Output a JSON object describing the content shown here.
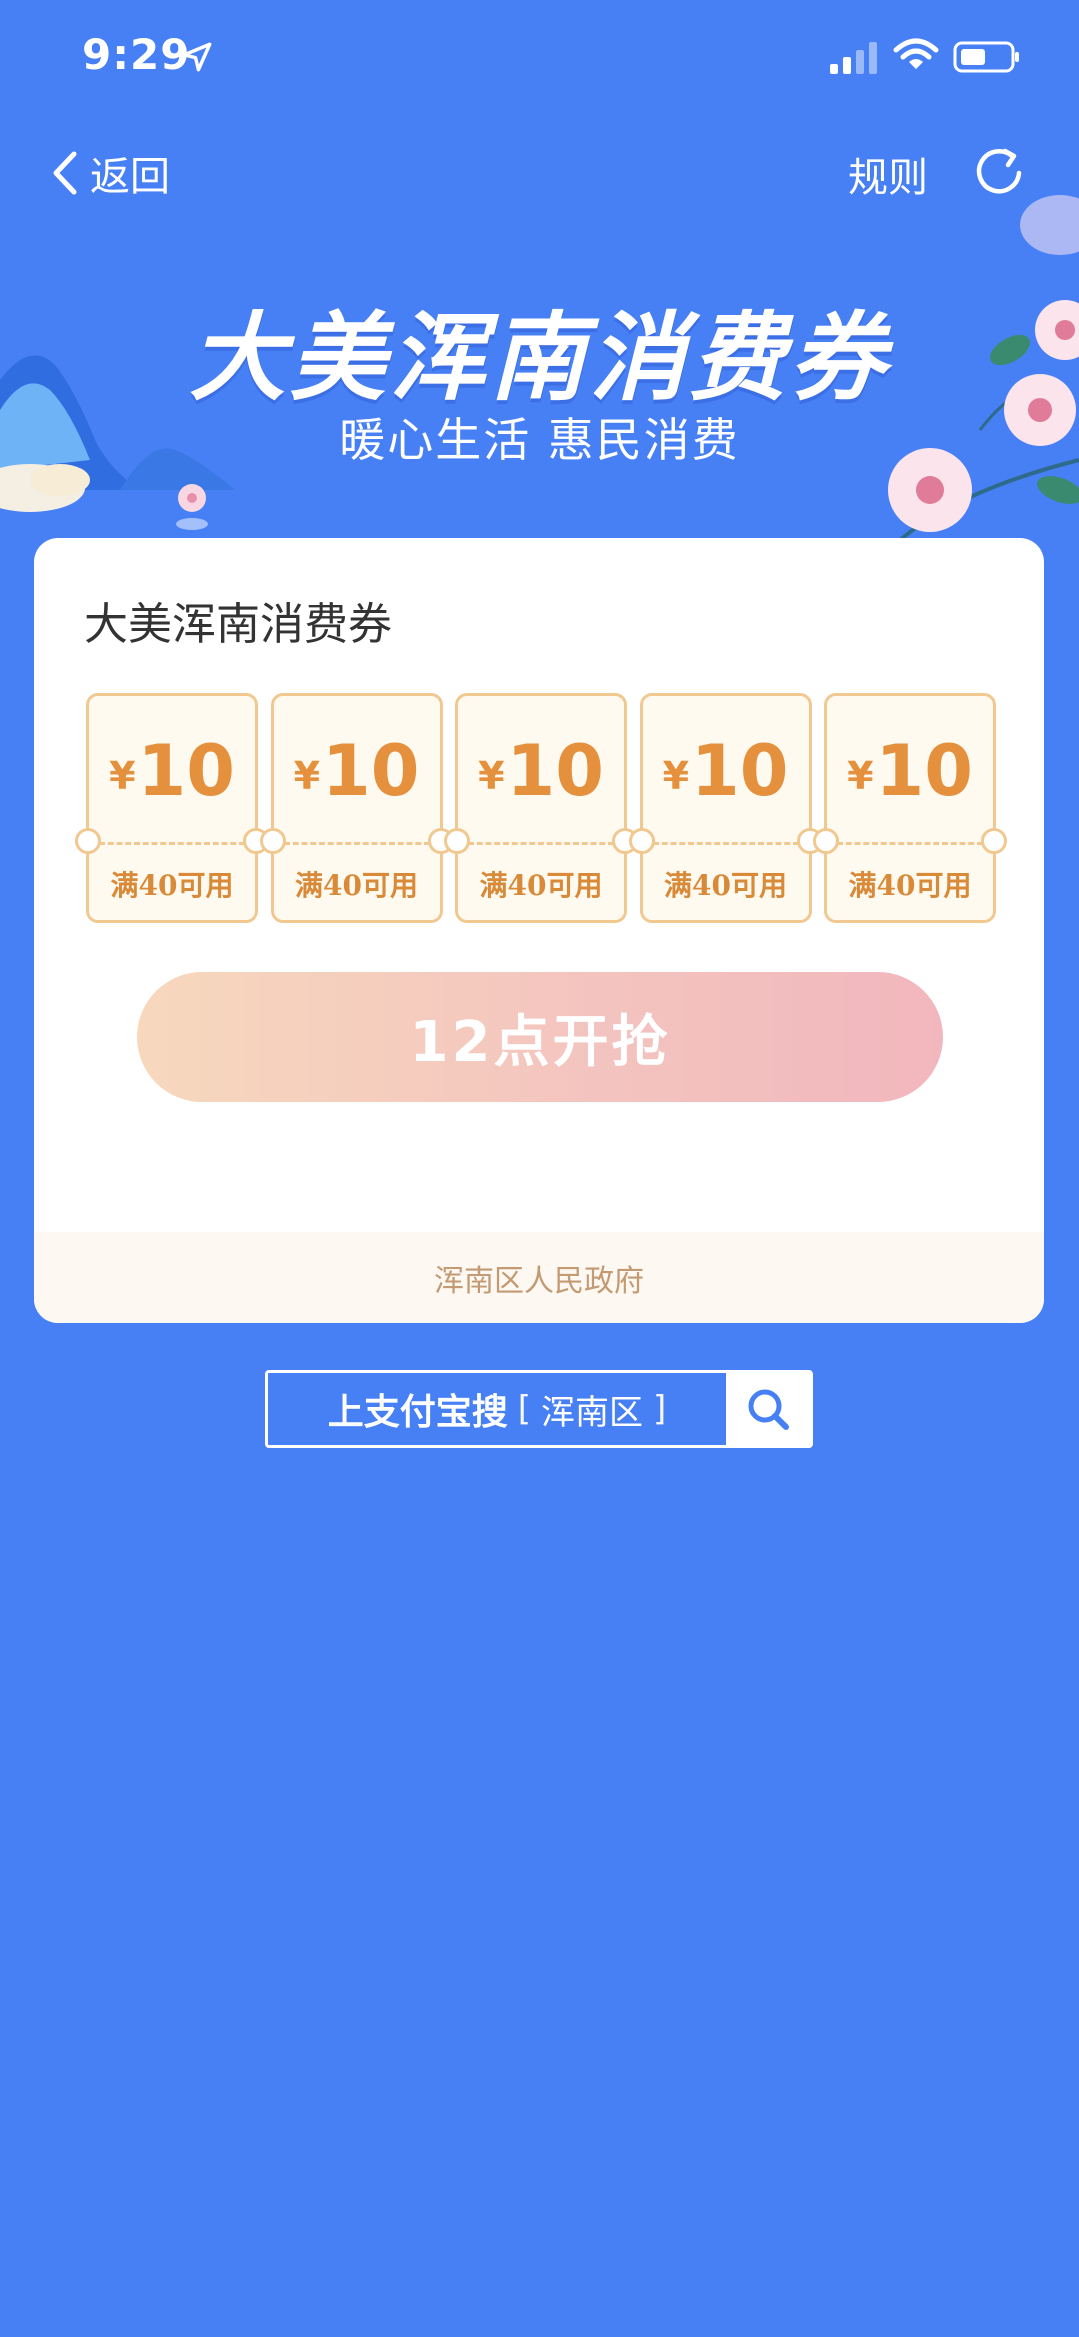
{
  "status_bar": {
    "time": "9:29"
  },
  "nav": {
    "back_label": "返回",
    "rules_label": "规则"
  },
  "banner": {
    "title": "大美浑南消费券",
    "subtitle": "暖心生活 惠民消费"
  },
  "card": {
    "title": "大美浑南消费券",
    "coupons": [
      {
        "currency": "¥",
        "value": "10",
        "condition": "满40可用"
      },
      {
        "currency": "¥",
        "value": "10",
        "condition": "满40可用"
      },
      {
        "currency": "¥",
        "value": "10",
        "condition": "满40可用"
      },
      {
        "currency": "¥",
        "value": "10",
        "condition": "满40可用"
      },
      {
        "currency": "¥",
        "value": "10",
        "condition": "满40可用"
      }
    ],
    "button_label": "12点开抢",
    "footer": "浑南区人民政府"
  },
  "search_hint": {
    "prefix": "上支付宝搜",
    "open_bracket": "[",
    "keyword": "浑南区",
    "close_bracket": "]"
  },
  "icons": {
    "back": "chevron-left-icon",
    "refresh": "refresh-icon",
    "search": "search-icon",
    "location": "location-arrow-icon",
    "signal": "signal-icon",
    "wifi": "wifi-icon",
    "battery": "battery-icon"
  },
  "colors": {
    "background": "#4780f5",
    "coupon_accent": "#e5903c",
    "coupon_border": "#f0c890",
    "footer_text": "#c49a73"
  }
}
